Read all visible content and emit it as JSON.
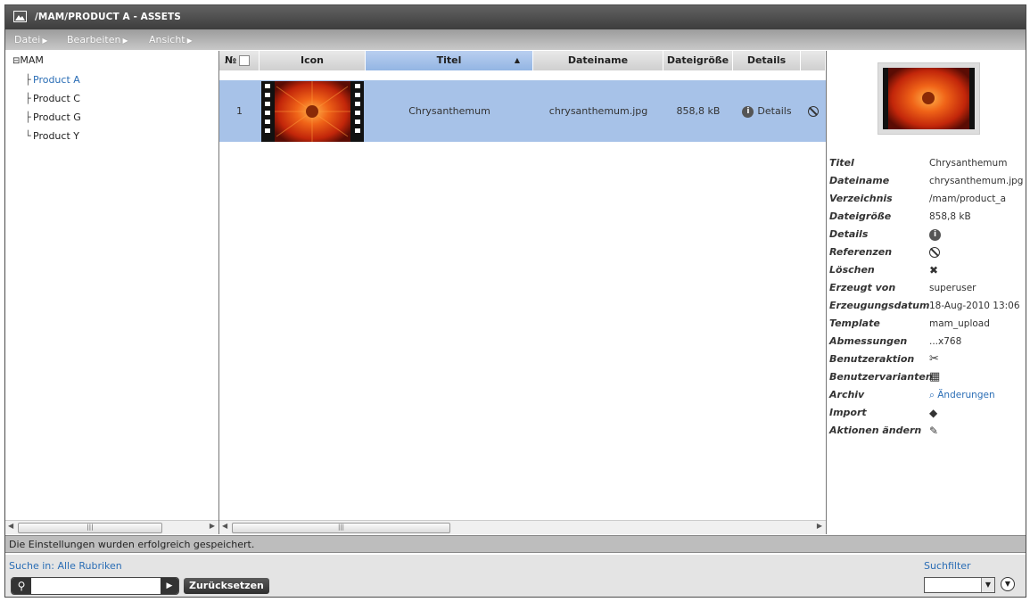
{
  "window": {
    "title": "/MAM/PRODUCT A - ASSETS"
  },
  "menu": [
    {
      "label": "Datei"
    },
    {
      "label": "Bearbeiten"
    },
    {
      "label": "Ansicht"
    }
  ],
  "tree": {
    "root": "MAM",
    "items": [
      {
        "label": "Product A",
        "connector": "├"
      },
      {
        "label": "Product C",
        "connector": "├"
      },
      {
        "label": "Product G",
        "connector": "├"
      },
      {
        "label": "Product Y",
        "connector": "└"
      }
    ]
  },
  "grid": {
    "columns": {
      "nr": "№",
      "icon": "Icon",
      "titel": "Titel",
      "dateiname": "Dateiname",
      "groesse": "Dateigröße",
      "details": "Details"
    },
    "row": {
      "nr": "1",
      "titel": "Chrysanthemum",
      "dateiname": "chrysanthemum.jpg",
      "groesse": "858,8 kB",
      "details": "Details"
    }
  },
  "props": {
    "titel": {
      "key": "Titel",
      "value": "Chrysanthemum"
    },
    "dateiname": {
      "key": "Dateiname",
      "value": "chrysanthemum.jpg"
    },
    "verzeichnis": {
      "key": "Verzeichnis",
      "value": "/mam/product_a"
    },
    "groesse": {
      "key": "Dateigröße",
      "value": "858,8 kB"
    },
    "details": {
      "key": "Details"
    },
    "referenzen": {
      "key": "Referenzen"
    },
    "loeschen": {
      "key": "Löschen"
    },
    "erzeugt_von": {
      "key": "Erzeugt von",
      "value": "superuser"
    },
    "erzeugungsdatum": {
      "key": "Erzeugungsdatum",
      "value": "18-Aug-2010 13:06"
    },
    "template": {
      "key": "Template",
      "value": "mam_upload"
    },
    "abmessungen": {
      "key": "Abmessungen",
      "value": "...x768"
    },
    "benutzeraktion": {
      "key": "Benutzeraktion"
    },
    "benutzervarianten": {
      "key": "Benutzervarianten"
    },
    "archiv": {
      "key": "Archiv",
      "value": "Änderungen"
    },
    "import": {
      "key": "Import"
    },
    "aktionen": {
      "key": "Aktionen ändern"
    }
  },
  "status": {
    "message": "Die Einstellungen wurden erfolgreich gespeichert."
  },
  "search": {
    "scope_label": "Suche in: Alle Rubriken",
    "value": "",
    "reset_label": "Zurücksetzen",
    "filter_label": "Suchfilter",
    "filter_value": ""
  },
  "colors": {
    "selected_row": "#a7c2e8",
    "link": "#2a6db5",
    "sorted_header": "#93b5e3"
  },
  "icons": {
    "details": "info-icon",
    "references": "no-entry-icon",
    "delete": "close-icon",
    "search": "search-icon"
  }
}
